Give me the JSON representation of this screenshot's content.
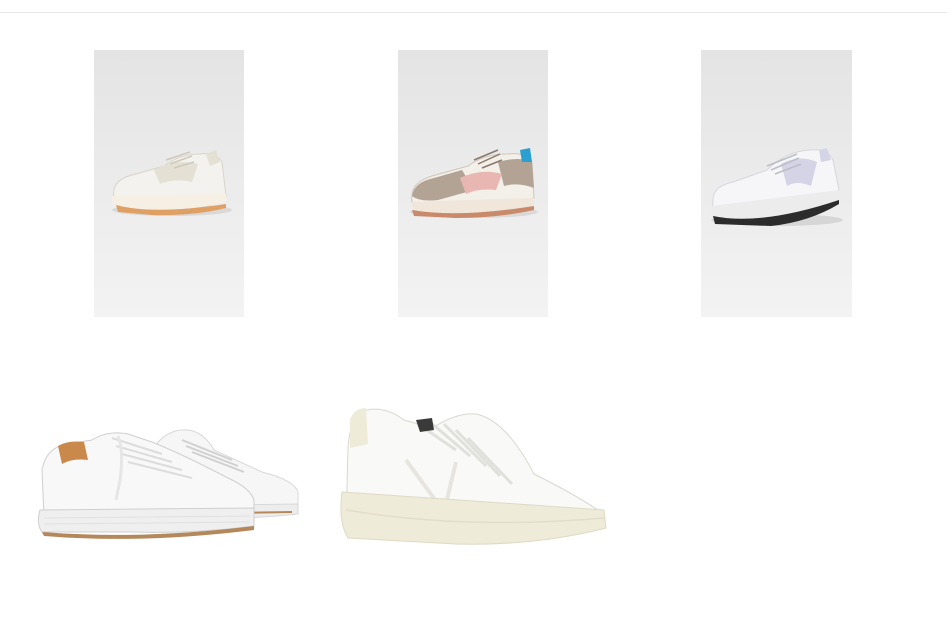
{
  "products": [
    {
      "name": "",
      "colors": {
        "body": "#f4f2ee",
        "accent": "#e4e0d4",
        "sole": "#f6efe4",
        "outsole": "#e0a064",
        "bg": "#e9e9e9"
      }
    },
    {
      "name": "",
      "colors": {
        "body": "#f3efe9",
        "accent": "#b3a394",
        "stripe": "#e8b7b1",
        "heel_tab": "#2a9fd0",
        "outsole": "#c98a6b",
        "bg": "#e9e9e9"
      }
    },
    {
      "name": "",
      "colors": {
        "body": "#f6f6f8",
        "accent": "#d4d4e6",
        "sole": "#ececec",
        "outsole": "#2c2c2c",
        "bg": "#e9e9e9"
      }
    },
    {
      "name": "",
      "colors": {
        "body": "#f8f8f8",
        "lining": "#c8894b",
        "sole": "#efefef",
        "outsole": "#b5885b",
        "bg": "#ffffff"
      }
    },
    {
      "name": "",
      "colors": {
        "body": "#f9f9f7",
        "sole": "#eeebd9",
        "bg": "#ffffff"
      }
    }
  ]
}
